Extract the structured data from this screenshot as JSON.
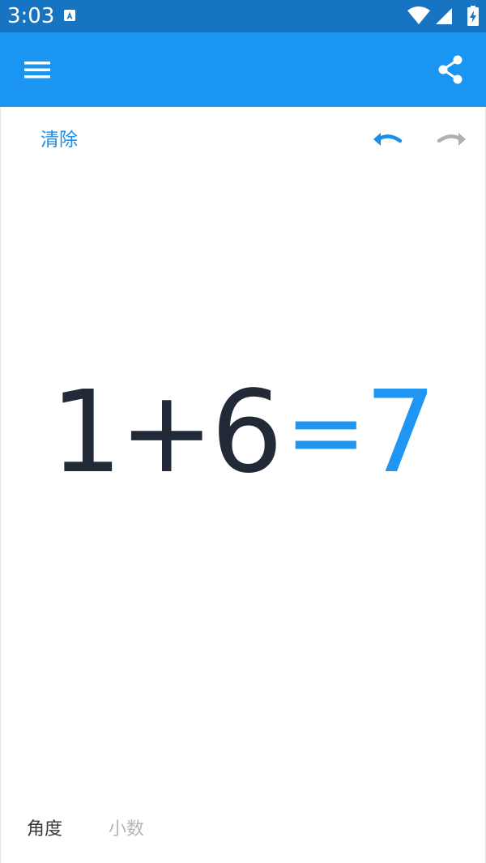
{
  "status_bar": {
    "time": "3:03",
    "notification_icon": "a-notification-icon",
    "icons": [
      "wifi-icon",
      "cell-signal-icon",
      "battery-charging-icon"
    ],
    "background": "#1774c2"
  },
  "app_bar": {
    "menu_icon": "hamburger-menu-icon",
    "share_icon": "share-icon",
    "background": "#1a95f1"
  },
  "toolbar": {
    "clear_label": "清除",
    "undo_icon": "undo-icon",
    "redo_icon": "redo-icon",
    "accent": "#1a8ee8",
    "redo_color": "#b0b0b0"
  },
  "display": {
    "expression": "1+6",
    "equals": "=",
    "result": "7",
    "expression_color": "#212a36",
    "result_color": "#1f97f2"
  },
  "modes": {
    "angle_label": "角度",
    "decimal_label": "小数"
  }
}
